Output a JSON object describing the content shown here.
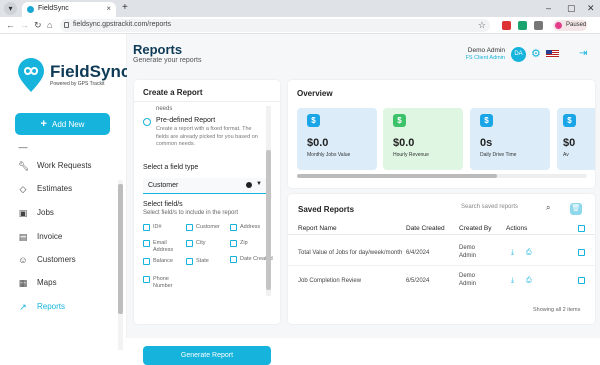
{
  "browser": {
    "tab_title": "FieldSync",
    "url": "fieldsync.gpstrackit.com/reports",
    "profile_status": "Paused"
  },
  "sidebar": {
    "logo_text": "FieldSync",
    "logo_sub": "Powered by GPS Trackit",
    "add_new": "Add New",
    "items": [
      {
        "label": "Work Requests",
        "icon": "wrench-icon"
      },
      {
        "label": "Estimates",
        "icon": "tag-icon"
      },
      {
        "label": "Jobs",
        "icon": "briefcase-icon"
      },
      {
        "label": "Invoice",
        "icon": "invoice-icon"
      },
      {
        "label": "Customers",
        "icon": "users-icon"
      },
      {
        "label": "Maps",
        "icon": "map-icon"
      },
      {
        "label": "Reports",
        "icon": "chart-icon"
      }
    ]
  },
  "header": {
    "title": "Reports",
    "subtitle": "Generate your reports",
    "user_name": "Demo Admin",
    "user_role": "FS Client Admin",
    "avatar_initials": "DA"
  },
  "create": {
    "title": "Create a Report",
    "cut_text": "needs",
    "option_title": "Pre-defined Report",
    "option_desc": "Create a report with a fixed format. The fields are already picked for you based on common needs.",
    "field_type_label": "Select a field type",
    "field_type_value": "Customer",
    "fields_label": "Select field/s",
    "fields_hint": "Select field/s to include in the report",
    "fields": [
      "ID#",
      "Customer",
      "Address",
      "Email Address",
      "City",
      "Zip",
      "Balance",
      "State",
      "Date Created",
      "Phone Number"
    ],
    "generate": "Generate Report"
  },
  "overview": {
    "title": "Overview",
    "tiles": [
      {
        "value": "$0.0",
        "label": "Monthly Jobs Value",
        "bg": "#dcedf9",
        "icon_bg": "#1aa6e6"
      },
      {
        "value": "$0.0",
        "label": "Hourly Revenue",
        "bg": "#dff6e2",
        "icon_bg": "#3cc36a"
      },
      {
        "value": "0s",
        "label": "Daily Drive Time",
        "bg": "#dcedf9",
        "icon_bg": "#1aa6e6"
      },
      {
        "value": "$0",
        "label": "Av",
        "bg": "#dcedf9",
        "icon_bg": "#1aa6e6"
      }
    ]
  },
  "saved": {
    "title": "Saved Reports",
    "search_placeholder": "Search saved reports",
    "columns": [
      "Report Name",
      "Date Created",
      "Created By",
      "Actions"
    ],
    "rows": [
      {
        "name": "Total Value of Jobs for day/week/month",
        "date": "6/4/2024",
        "by": "Demo Admin"
      },
      {
        "name": "Job Completion Review",
        "date": "6/5/2024",
        "by": "Demo Admin"
      }
    ],
    "footer": "Showing all 2 items"
  }
}
